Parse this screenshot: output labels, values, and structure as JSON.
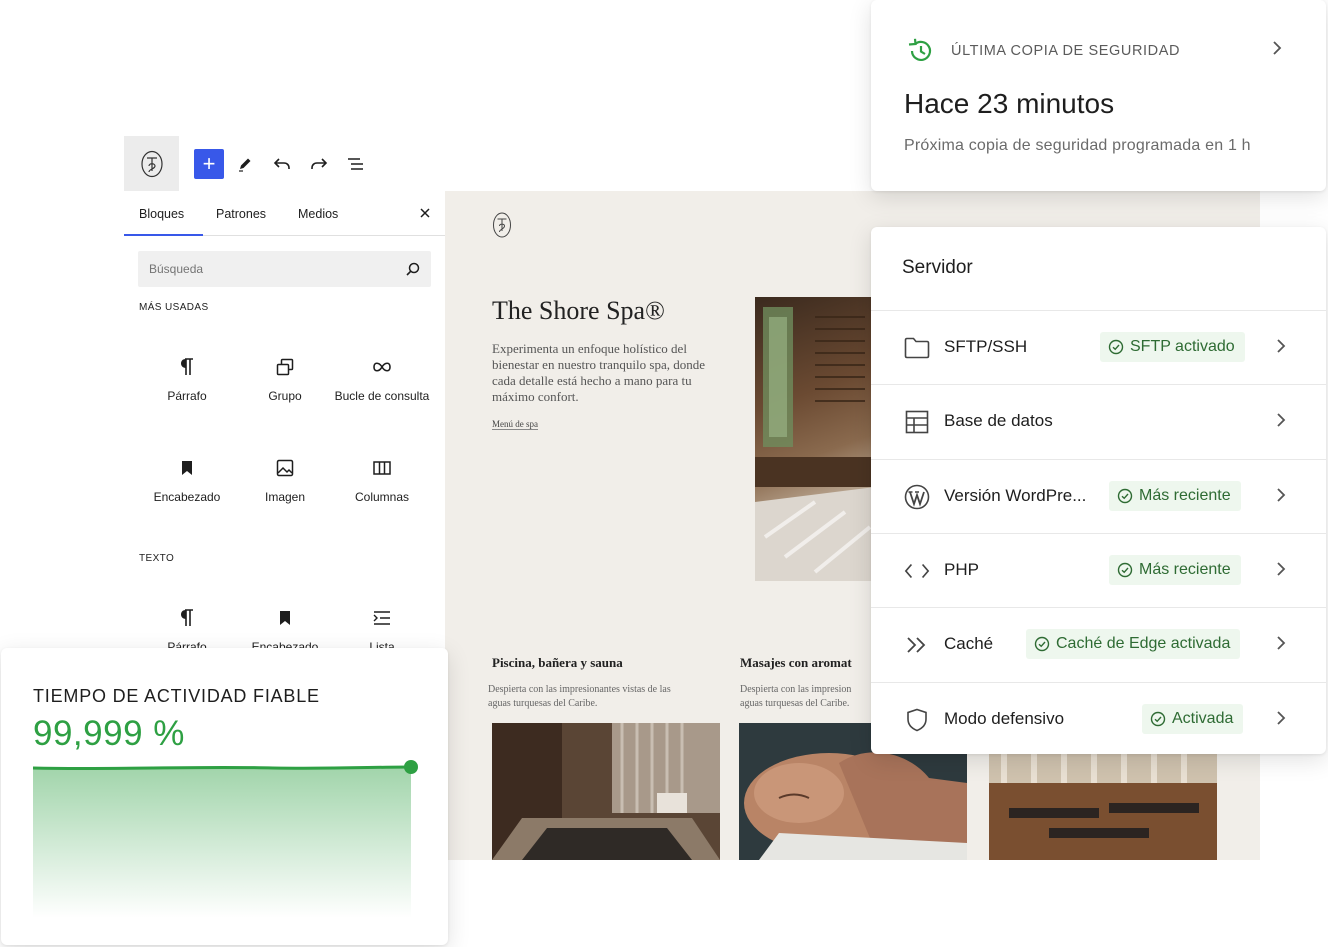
{
  "toolbar": {
    "logo_icon": "ts-monogram-logo",
    "items": [
      {
        "name": "add-block-button",
        "icon": "plus-icon"
      },
      {
        "name": "tools-button",
        "icon": "pencil-icon"
      },
      {
        "name": "undo-button",
        "icon": "undo-icon"
      },
      {
        "name": "redo-button",
        "icon": "redo-icon"
      },
      {
        "name": "list-view-button",
        "icon": "list-view-icon"
      }
    ]
  },
  "inserter": {
    "tabs": [
      "Bloques",
      "Patrones",
      "Medios"
    ],
    "active_tab": "Bloques",
    "search_placeholder": "Búsqueda",
    "most_used_label": "MÁS USADAS",
    "most_used": [
      "Párrafo",
      "Grupo",
      "Bucle de consulta",
      "Encabezado",
      "Imagen",
      "Columnas"
    ],
    "text_label": "TEXTO",
    "text_blocks": [
      "Párrafo",
      "Encabezado",
      "Lista"
    ]
  },
  "preview": {
    "title": "The Shore Spa®",
    "description": "Experimenta un enfoque holístico del bienestar en nuestro tranquilo spa, donde cada detalle está hecho a mano para tu máximo confort.",
    "link": "Menú de spa",
    "cards": [
      {
        "title": "Piscina, bañera y sauna",
        "desc_1": "Despierta con las impresionantes vistas de las",
        "desc_2": "aguas turquesas del Caribe."
      },
      {
        "title": "Masajes con aromat",
        "desc_1": "Despierta con las impresion",
        "desc_2": "aguas turquesas del Caribe."
      }
    ]
  },
  "backup": {
    "label": "ÚLTIMA COPIA DE SEGURIDAD",
    "time": "Hace 23 minutos",
    "next": "Próxima copia de seguridad programada en 1 h"
  },
  "server": {
    "title": "Servidor",
    "rows": [
      {
        "label": "SFTP/SSH",
        "badge": "SFTP activado",
        "icon": "folder-icon"
      },
      {
        "label": "Base de datos",
        "badge": "",
        "icon": "database-table-icon"
      },
      {
        "label": "Versión WordPre...",
        "badge": "Más reciente",
        "icon": "wordpress-icon"
      },
      {
        "label": "PHP",
        "badge": "Más reciente",
        "icon": "code-icon"
      },
      {
        "label": "Caché",
        "badge": "Caché de Edge activada",
        "icon": "double-chevron-icon"
      },
      {
        "label": "Modo defensivo",
        "badge": "Activada",
        "icon": "shield-icon"
      }
    ]
  },
  "uptime": {
    "label": "TIEMPO DE ACTIVIDAD FIABLE",
    "value": "99,999 %",
    "color": "#2ea043"
  },
  "colors": {
    "accent_blue": "#3858e9",
    "success_green": "#2ea043",
    "badge_bg": "#eef7ee"
  }
}
